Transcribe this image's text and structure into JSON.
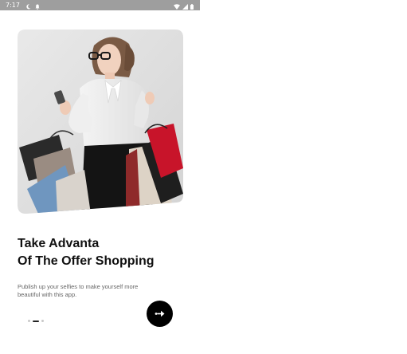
{
  "status_bar": {
    "time": "7:17",
    "left_icons": [
      "moon-icon",
      "notification-icon"
    ],
    "right_icons": [
      "wifi-icon",
      "signal-icon",
      "battery-icon"
    ]
  },
  "onboarding": {
    "hero_image": "woman-with-shopping-bags",
    "title_line1": "Take Advanta",
    "title_line2": "Of The Offer Shopping",
    "description": "Publish up your selfies to make yourself more beautiful with this app.",
    "pager": {
      "total": 3,
      "active_index": 1
    },
    "next_button_icon": "arrow-right-icon"
  }
}
